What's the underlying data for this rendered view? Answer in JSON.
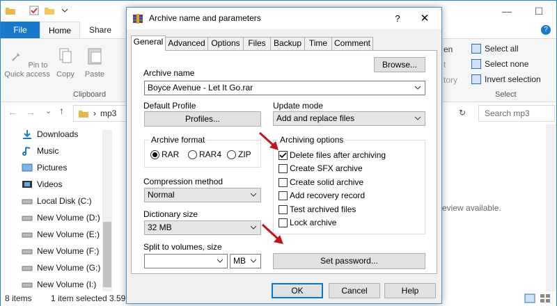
{
  "explorer": {
    "tabs": {
      "file": "File",
      "home": "Home",
      "share": "Share"
    },
    "ribbon": {
      "pin_label": "Pin to Quick access",
      "copy_label": "Copy",
      "paste_label": "Paste",
      "clipboard_group": "Clipboard",
      "open_fragment": "en",
      "t_fragment": "t",
      "tory_fragment": "tory",
      "select_all": "Select all",
      "select_none": "Select none",
      "invert_selection": "Invert selection",
      "select_group": "Select"
    },
    "address": {
      "path": "mp3",
      "search_placeholder": "Search mp3"
    },
    "nav_items": [
      "Downloads",
      "Music",
      "Pictures",
      "Videos",
      "Local Disk (C:)",
      "New Volume (D:)",
      "New Volume (E:)",
      "New Volume (F:)",
      "New Volume (G:)",
      "New Volume (I:)"
    ],
    "preview_text": "eview available.",
    "status": {
      "items": "8 items",
      "selected": "1 item selected",
      "size": "3.59"
    }
  },
  "dialog": {
    "title": "Archive name and parameters",
    "help": "?",
    "close": "✕",
    "tabs": [
      "General",
      "Advanced",
      "Options",
      "Files",
      "Backup",
      "Time",
      "Comment"
    ],
    "archive_name_label": "Archive name",
    "browse": "Browse...",
    "archive_name_value": "Boyce Avenue - Let It Go.rar",
    "default_profile_label": "Default Profile",
    "profiles": "Profiles...",
    "update_mode_label": "Update mode",
    "update_mode_value": "Add and replace files",
    "archive_format_label": "Archive format",
    "format_options": [
      "RAR",
      "RAR4",
      "ZIP"
    ],
    "format_selected": "RAR",
    "compression_label": "Compression method",
    "compression_value": "Normal",
    "dictionary_label": "Dictionary size",
    "dictionary_value": "32 MB",
    "split_label": "Split to volumes, size",
    "split_value": "",
    "split_unit": "MB",
    "archiving_options_label": "Archiving options",
    "archiving_options": [
      {
        "label": "Delete files after archiving",
        "checked": true
      },
      {
        "label": "Create SFX archive",
        "checked": false
      },
      {
        "label": "Create solid archive",
        "checked": false
      },
      {
        "label": "Add recovery record",
        "checked": false
      },
      {
        "label": "Test archived files",
        "checked": false
      },
      {
        "label": "Lock archive",
        "checked": false
      }
    ],
    "set_password": "Set password...",
    "ok": "OK",
    "cancel": "Cancel",
    "help_button": "Help"
  },
  "colors": {
    "accent": "#0078d7",
    "file_tab": "#1979ca",
    "annotation_arrow": "#c0141c"
  }
}
